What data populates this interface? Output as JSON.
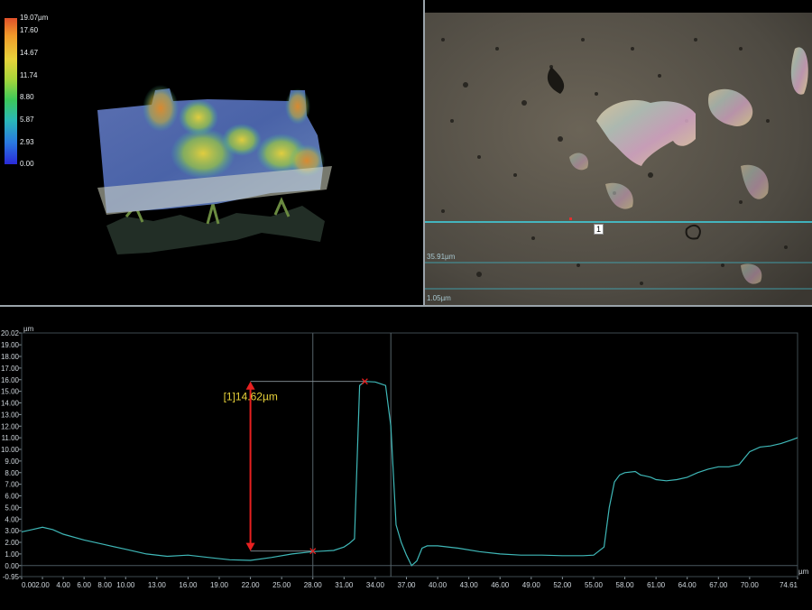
{
  "height_scale": {
    "labels": [
      "19.07µm",
      "17.60",
      "14.67",
      "11.74",
      "8.80",
      "5.87",
      "2.93",
      "0.00"
    ],
    "values": [
      19.07,
      17.6,
      14.67,
      11.74,
      8.8,
      5.87,
      2.93,
      0.0
    ],
    "colors": [
      "#e0502a",
      "#f09a2a",
      "#e8d23a",
      "#a6d43a",
      "#3cc85a",
      "#2ab8b8",
      "#2a7ae0",
      "#2a2ad8"
    ]
  },
  "line_labels": {
    "upper": "35.91µm",
    "lower": "1.05µm",
    "marker": "1"
  },
  "profile": {
    "unit_y": "µm",
    "unit_x": "µm",
    "measurement_label": "[1]14.62µm",
    "y_ticks": [
      "20.02",
      "19.00",
      "18.00",
      "17.00",
      "16.00",
      "15.00",
      "14.00",
      "13.00",
      "12.00",
      "11.00",
      "10.00",
      "9.00",
      "8.00",
      "7.00",
      "6.00",
      "5.00",
      "4.00",
      "3.00",
      "2.00",
      "1.00",
      "0.00",
      "-0.95"
    ],
    "x_ticks": [
      "0.00",
      "2.00",
      "4.00",
      "6.00",
      "8.00",
      "10.00",
      "13.00",
      "16.00",
      "19.00",
      "22.00",
      "25.00",
      "28.00",
      "31.00",
      "34.00",
      "37.00",
      "40.00",
      "43.00",
      "46.00",
      "49.00",
      "52.00",
      "55.00",
      "58.00",
      "61.00",
      "64.00",
      "67.00",
      "70.00",
      "74.61"
    ]
  },
  "chart_data": {
    "type": "line",
    "title": "",
    "xlabel": "µm",
    "ylabel": "µm",
    "xlim": [
      0,
      74.61
    ],
    "ylim": [
      -0.95,
      20.02
    ],
    "grid": false,
    "series": [
      {
        "x": [
          0,
          1,
          2,
          3,
          4,
          6,
          8,
          10,
          12,
          14,
          16,
          18,
          20,
          22,
          24,
          26,
          28,
          29,
          30,
          31,
          31.5,
          32,
          32.5,
          33,
          34,
          35,
          35.5,
          36,
          36.5,
          37,
          37.5,
          38,
          38.5,
          39,
          40,
          42,
          44,
          46,
          48,
          50,
          52,
          54,
          55,
          56,
          56.5,
          57,
          57.5,
          58,
          59,
          59.5,
          60,
          60.5,
          61,
          62,
          63,
          64,
          65,
          66,
          67,
          68,
          69,
          70,
          71,
          72,
          73,
          74,
          74.61
        ],
        "y": [
          2.9,
          3.1,
          3.3,
          3.1,
          2.7,
          2.2,
          1.8,
          1.4,
          1.0,
          0.8,
          0.9,
          0.7,
          0.5,
          0.45,
          0.7,
          1.0,
          1.2,
          1.25,
          1.3,
          1.6,
          1.9,
          2.3,
          15.5,
          15.85,
          15.8,
          15.5,
          12.0,
          3.5,
          2.0,
          0.9,
          0.0,
          0.4,
          1.5,
          1.7,
          1.7,
          1.5,
          1.2,
          1.0,
          0.9,
          0.9,
          0.85,
          0.85,
          0.9,
          1.6,
          5.0,
          7.2,
          7.8,
          8.0,
          8.1,
          7.8,
          7.7,
          7.6,
          7.4,
          7.3,
          7.4,
          7.6,
          8.0,
          8.3,
          8.5,
          8.5,
          8.7,
          9.8,
          10.2,
          10.3,
          10.5,
          10.8,
          11.0
        ]
      }
    ],
    "markers": [
      {
        "x": 28,
        "y": 1.25
      },
      {
        "x": 33,
        "y": 15.85
      }
    ],
    "measurement": {
      "label": "[1]14.62µm",
      "value": 14.62
    },
    "vertical_lines": [
      28,
      35.5
    ]
  }
}
